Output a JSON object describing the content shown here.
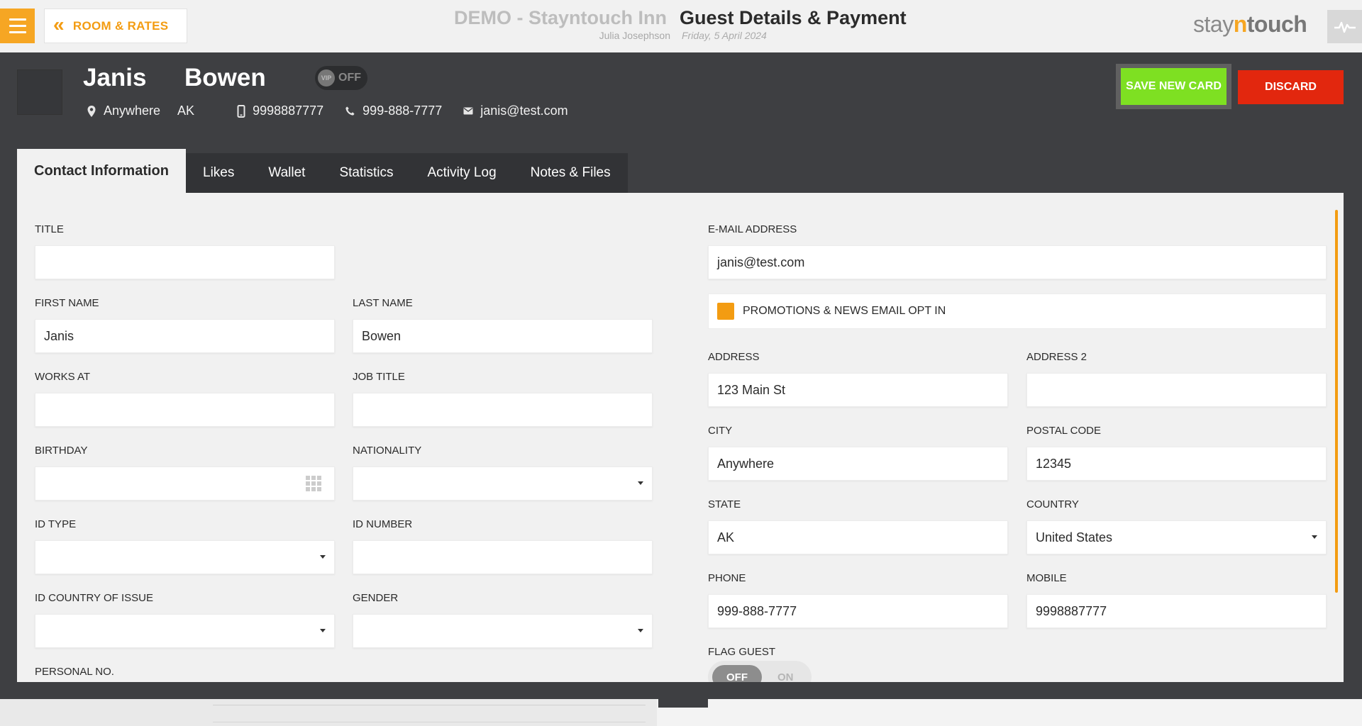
{
  "header": {
    "back_label": "ROOM & RATES",
    "hotel": "DEMO - Stayntouch Inn",
    "user": "Julia Josephson",
    "title": "Guest Details & Payment",
    "date": "Friday, 5 April 2024",
    "brand_part1": "stay",
    "brand_part2": "n",
    "brand_part3": "touch"
  },
  "guest": {
    "first_name": "Janis",
    "last_name": "Bowen",
    "vip_label": "VIP",
    "vip_state": "OFF",
    "city": "Anywhere",
    "state": "AK",
    "mobile": "9998887777",
    "phone": "999-888-7777",
    "email": "janis@test.com"
  },
  "actions": {
    "save_card": "SAVE NEW CARD",
    "discard": "DISCARD"
  },
  "tabs": [
    {
      "label": "Contact Information"
    },
    {
      "label": "Likes"
    },
    {
      "label": "Wallet"
    },
    {
      "label": "Statistics"
    },
    {
      "label": "Activity Log"
    },
    {
      "label": "Notes & Files"
    }
  ],
  "form": {
    "title": {
      "label": "TITLE",
      "value": ""
    },
    "first_name": {
      "label": "FIRST NAME",
      "value": "Janis"
    },
    "last_name": {
      "label": "LAST NAME",
      "value": "Bowen"
    },
    "works_at": {
      "label": "WORKS AT",
      "value": ""
    },
    "job_title": {
      "label": "JOB TITLE",
      "value": ""
    },
    "birthday": {
      "label": "BIRTHDAY",
      "value": ""
    },
    "nationality": {
      "label": "NATIONALITY",
      "value": ""
    },
    "id_type": {
      "label": "ID TYPE",
      "value": ""
    },
    "id_number": {
      "label": "ID NUMBER",
      "value": ""
    },
    "id_country": {
      "label": "ID COUNTRY OF ISSUE",
      "value": ""
    },
    "gender": {
      "label": "GENDER",
      "value": ""
    },
    "personal_no": {
      "label": "PERSONAL NO.",
      "value": ""
    },
    "email": {
      "label": "E-MAIL ADDRESS",
      "value": "janis@test.com"
    },
    "optin": {
      "label": "PROMOTIONS & NEWS EMAIL OPT IN",
      "checked": true
    },
    "address": {
      "label": "ADDRESS",
      "value": "123 Main St"
    },
    "address2": {
      "label": "ADDRESS 2",
      "value": ""
    },
    "city": {
      "label": "CITY",
      "value": "Anywhere"
    },
    "postal_code": {
      "label": "POSTAL CODE",
      "value": "12345"
    },
    "state": {
      "label": "STATE",
      "value": "AK"
    },
    "country": {
      "label": "COUNTRY",
      "value": "United States"
    },
    "phone": {
      "label": "PHONE",
      "value": "999-888-7777"
    },
    "mobile": {
      "label": "MOBILE",
      "value": "9998887777"
    },
    "flag_guest": {
      "label": "FLAG GUEST",
      "off_label": "OFF",
      "on_label": "ON",
      "state": "OFF"
    }
  },
  "colors": {
    "accent": "#f39c12",
    "save": "#7ee022",
    "discard": "#e2270e",
    "dark_bg": "#3e3f42"
  }
}
